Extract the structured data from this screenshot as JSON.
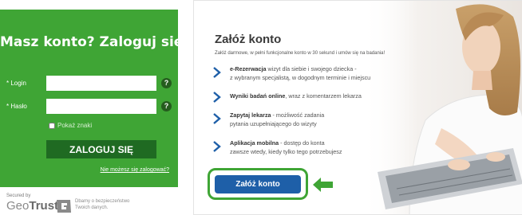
{
  "login": {
    "title": "Masz konto? Zaloguj się",
    "login_label": "* Login",
    "password_label": "* Hasło",
    "help_icon_glyph": "?",
    "show_chars_label": "Pokaż znaki",
    "submit_label": "ZALOGUJ SIĘ",
    "forgot_link": "Nie możesz się zalogować?",
    "panel_color": "#3fa535",
    "button_color": "#1f6a22"
  },
  "trust": {
    "secured_by": "Secured by",
    "brand_light": "Geo",
    "brand_bold": "Trust",
    "note_line1": "Dbamy o bezpieczeństwo",
    "note_line2": "Twoich danych."
  },
  "register": {
    "title": "Załóż konto",
    "subtitle": "Załóż darmowe, w pełni funkcjonalne konto w 30 sekund i umów się na badania!",
    "benefits": [
      {
        "bold": "e-Rezerwacja",
        "text": " wizyt dla siebie i swojego dziecka -",
        "line2": "z wybranym specjalistą, w dogodnym terminie i miejscu"
      },
      {
        "bold": "Wyniki badań online",
        "text": ", wraz z komentarzem lekarza",
        "line2": ""
      },
      {
        "bold": "Zapytaj lekarza",
        "text": " - możliwość zadania",
        "line2": "pytania uzupełniającego do wizyty"
      },
      {
        "bold": "Aplikacja mobilna",
        "text": " - dostęp do konta",
        "line2": "zawsze wtedy, kiedy tylko tego potrzebujesz"
      }
    ],
    "cta_label": "Załóż konto",
    "arrow_color": "#1e5fa8",
    "cta_color": "#1e5fa8",
    "highlight_color": "#3fa535"
  }
}
